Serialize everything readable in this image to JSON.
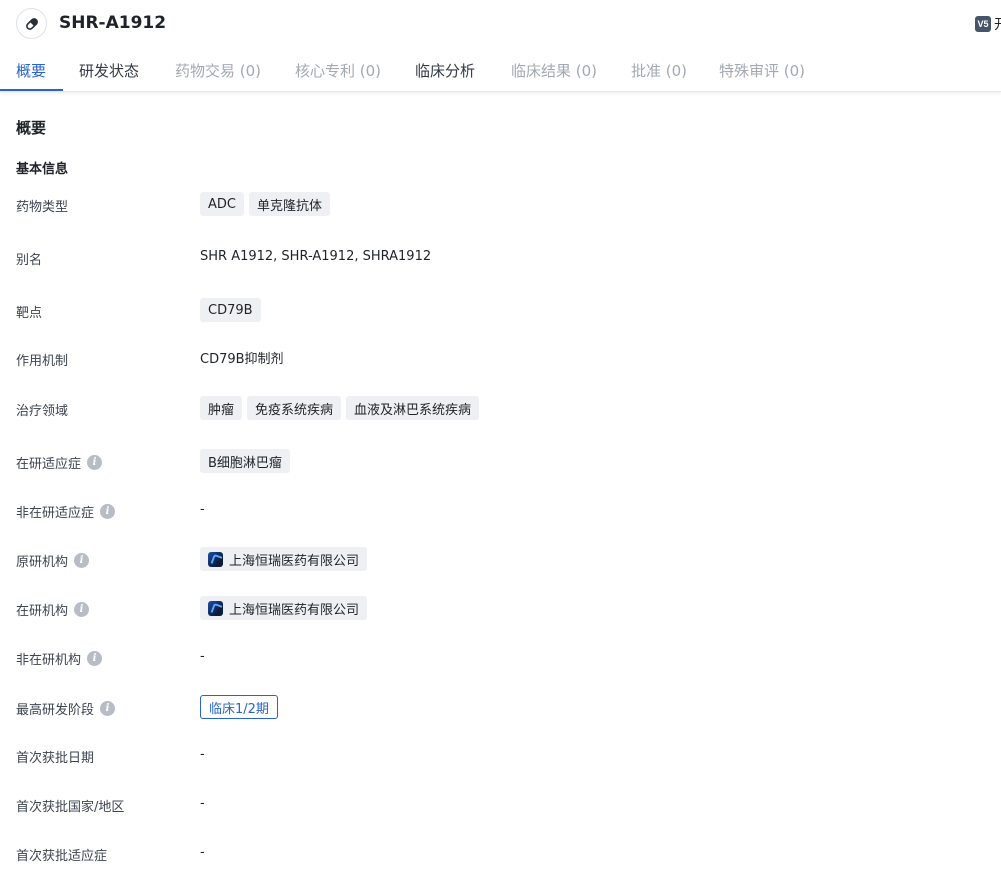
{
  "header": {
    "drug_name": "SHR-A1912",
    "version_badge": "V5",
    "cut_text": "开"
  },
  "tabs": [
    {
      "label": "概要",
      "state": "active"
    },
    {
      "label": "研发状态",
      "state": "enabled"
    },
    {
      "label": "药物交易 (0)",
      "state": "disabled"
    },
    {
      "label": "核心专利 (0)",
      "state": "disabled"
    },
    {
      "label": "临床分析",
      "state": "enabled"
    },
    {
      "label": "临床结果 (0)",
      "state": "disabled"
    },
    {
      "label": "批准 (0)",
      "state": "disabled"
    },
    {
      "label": "特殊审评 (0)",
      "state": "disabled"
    }
  ],
  "overview": {
    "section_title": "概要",
    "subsection_title": "基本信息",
    "rows": {
      "drug_type": {
        "label": "药物类型",
        "tags": [
          "ADC",
          "单克隆抗体"
        ]
      },
      "alias": {
        "label": "别名",
        "value": "SHR A1912,  SHR-A1912,  SHRA1912"
      },
      "target": {
        "label": "靶点",
        "tags": [
          "CD79B"
        ]
      },
      "mechanism": {
        "label": "作用机制",
        "value": "CD79B抑制剂"
      },
      "therapeutic_area": {
        "label": "治疗领域",
        "tags": [
          "肿瘤",
          "免疫系统疾病",
          "血液及淋巴系统疾病"
        ]
      },
      "active_indication": {
        "label": "在研适应症",
        "tags": [
          "B细胞淋巴瘤"
        ]
      },
      "inactive_indication": {
        "label": "非在研适应症",
        "value": "-"
      },
      "originator": {
        "label": "原研机构",
        "org": "上海恒瑞医药有限公司"
      },
      "active_org": {
        "label": "在研机构",
        "org": "上海恒瑞医药有限公司"
      },
      "inactive_org": {
        "label": "非在研机构",
        "value": "-"
      },
      "highest_phase": {
        "label": "最高研发阶段",
        "phase": "临床1/2期"
      },
      "first_approval_date": {
        "label": "首次获批日期",
        "value": "-"
      },
      "first_approval_country": {
        "label": "首次获批国家/地区",
        "value": "-"
      },
      "first_approval_indication": {
        "label": "首次获批适应症",
        "value": "-"
      }
    }
  },
  "colors": {
    "accent": "#2a63c9",
    "tag_bg": "#eef0f3",
    "disabled_text": "#a3a9b3"
  }
}
